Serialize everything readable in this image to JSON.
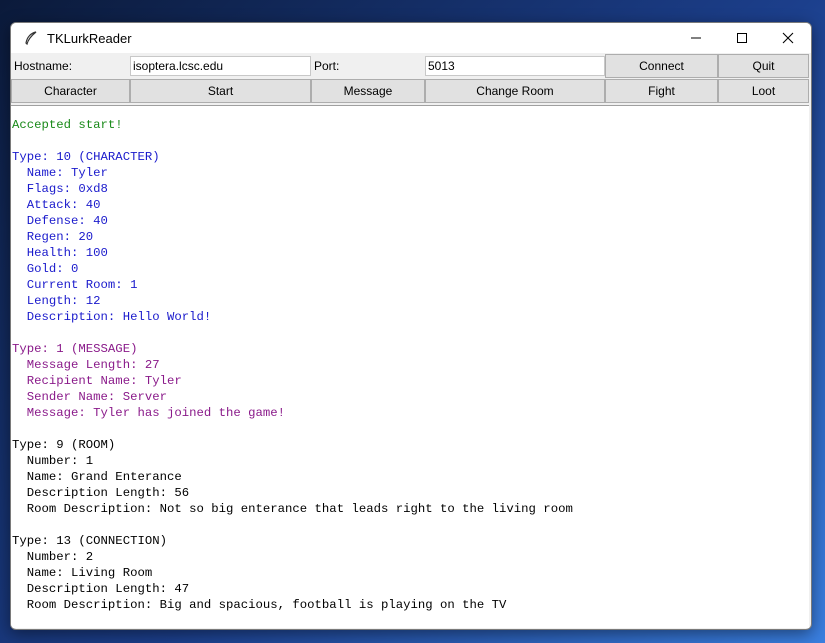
{
  "window": {
    "title": "TKLurkReader"
  },
  "connection": {
    "hostname_label": "Hostname:",
    "hostname_value": "isoptera.lcsc.edu",
    "port_label": "Port:",
    "port_value": "5013",
    "connect_label": "Connect",
    "quit_label": "Quit"
  },
  "actions": {
    "character": "Character",
    "start": "Start",
    "message": "Message",
    "change_room": "Change Room",
    "fight": "Fight",
    "loot": "Loot"
  },
  "colors": {
    "accepted": "#1a8a1a",
    "character": "#1a1acc",
    "message": "#8a1a8a",
    "room": "#000000"
  },
  "output": {
    "accepted": "Accepted start!",
    "character": [
      "Type: 10 (CHARACTER)",
      "  Name: Tyler",
      "  Flags: 0xd8",
      "  Attack: 40",
      "  Defense: 40",
      "  Regen: 20",
      "  Health: 100",
      "  Gold: 0",
      "  Current Room: 1",
      "  Length: 12",
      "  Description: Hello World!"
    ],
    "message": [
      "Type: 1 (MESSAGE)",
      "  Message Length: 27",
      "  Recipient Name: Tyler",
      "  Sender Name: Server",
      "  Message: Tyler has joined the game!"
    ],
    "room": [
      "Type: 9 (ROOM)",
      "  Number: 1",
      "  Name: Grand Enterance",
      "  Description Length: 56",
      "  Room Description: Not so big enterance that leads right to the living room"
    ],
    "connection": [
      "Type: 13 (CONNECTION)",
      "  Number: 2",
      "  Name: Living Room",
      "  Description Length: 47",
      "  Room Description: Big and spacious, football is playing on the TV"
    ]
  }
}
